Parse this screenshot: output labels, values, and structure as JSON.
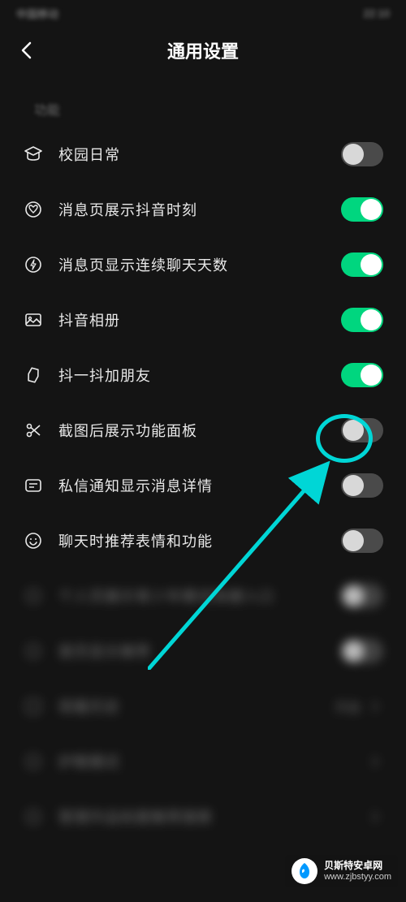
{
  "statusBar": {
    "left": "中国移动",
    "right": "22:10"
  },
  "header": {
    "title": "通用设置"
  },
  "section": {
    "label": "功能"
  },
  "settings": [
    {
      "icon": "graduation",
      "label": "校园日常",
      "on": false
    },
    {
      "icon": "heart-circle",
      "label": "消息页展示抖音时刻",
      "on": true
    },
    {
      "icon": "lightning",
      "label": "消息页显示连续聊天天数",
      "on": true
    },
    {
      "icon": "image",
      "label": "抖音相册",
      "on": true
    },
    {
      "icon": "shake",
      "label": "抖一抖加朋友",
      "on": true
    },
    {
      "icon": "scissors",
      "label": "截图后展示功能面板",
      "on": false
    },
    {
      "icon": "message",
      "label": "私信通知显示消息详情",
      "on": false
    },
    {
      "icon": "emoji",
      "label": "聊天时推荐表情和功能",
      "on": false
    }
  ],
  "blurredSettings": [
    {
      "label": "个人页展示青少年模式快捷入口",
      "type": "toggle",
      "on": false
    },
    {
      "label": "首页显示推荐",
      "type": "toggle",
      "on": false
    },
    {
      "label": "观看历史",
      "type": "arrow",
      "value": "开启"
    },
    {
      "label": "护眼模式",
      "type": "arrow",
      "value": ""
    },
    {
      "label": "管理作品标题推荐搜索",
      "type": "arrow",
      "value": ""
    }
  ],
  "watermark": {
    "name": "贝斯特安卓网",
    "url": "www.zjbstyy.com"
  }
}
